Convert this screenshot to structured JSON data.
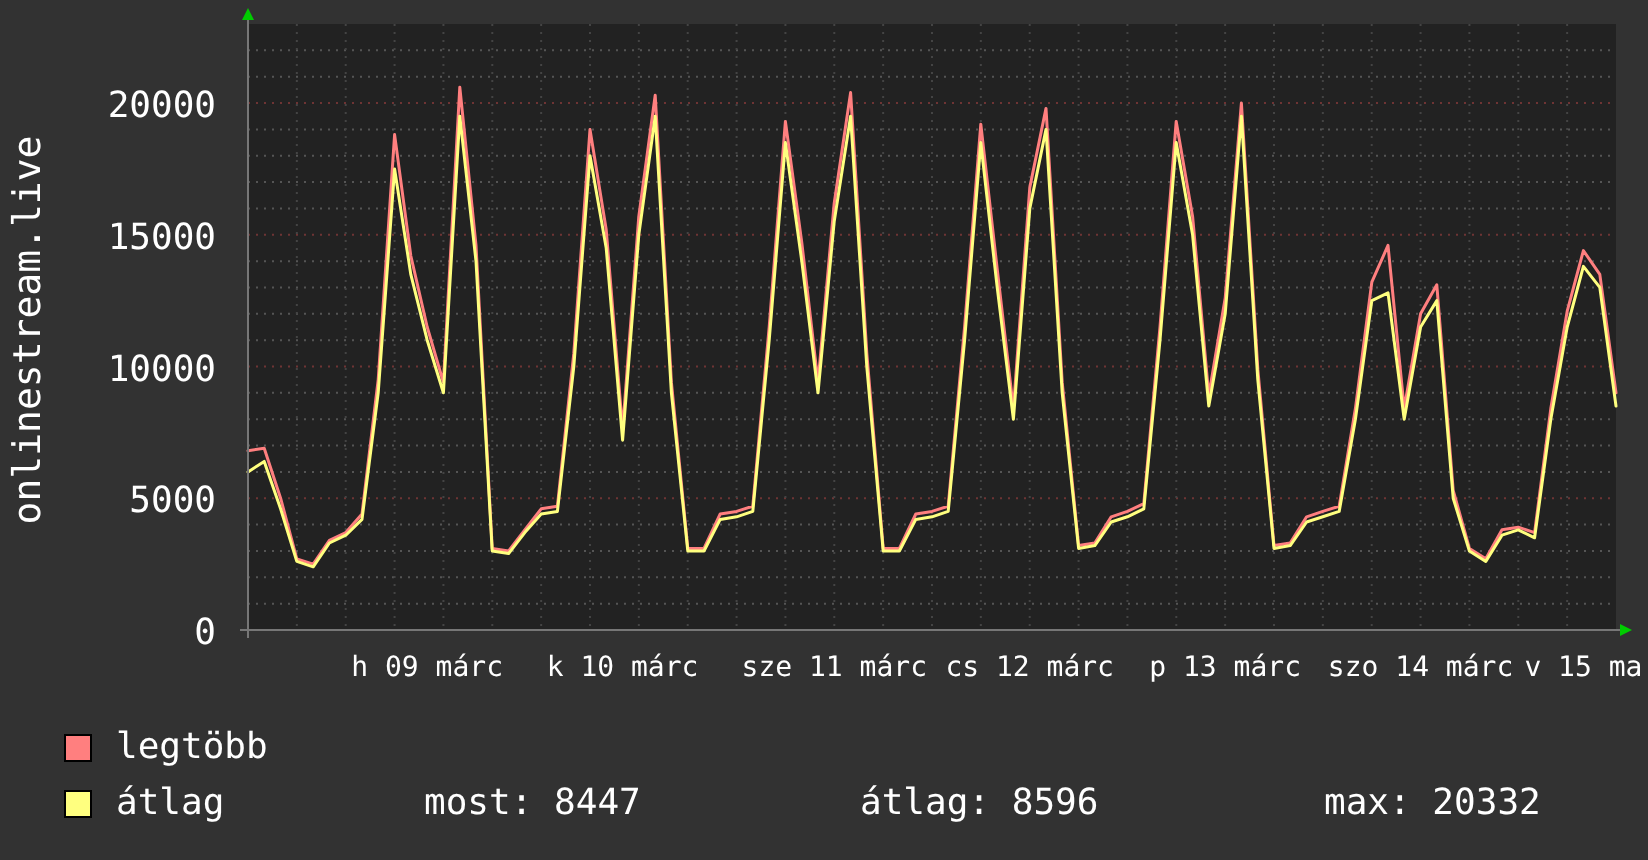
{
  "chart_data": {
    "type": "line",
    "ylabel": "onlinestream.live",
    "categories": [
      null,
      null,
      null,
      null,
      null,
      null,
      null,
      null,
      null,
      null,
      null,
      "h 09 márc",
      null,
      null,
      null,
      null,
      null,
      null,
      null,
      null,
      null,
      null,
      null,
      "k 10 márc",
      null,
      null,
      null,
      null,
      null,
      null,
      null,
      null,
      null,
      null,
      null,
      null,
      "sze 11 márc",
      null,
      null,
      null,
      null,
      null,
      null,
      null,
      null,
      null,
      null,
      null,
      "cs 12 márc",
      null,
      null,
      null,
      null,
      null,
      null,
      null,
      null,
      null,
      null,
      null,
      "p 13 márc",
      null,
      null,
      null,
      null,
      null,
      null,
      null,
      null,
      null,
      null,
      null,
      "szo 14 márc",
      null,
      null,
      null,
      null,
      null,
      null,
      null,
      null,
      null,
      "v 15 ma",
      null,
      null
    ],
    "ylim": [
      0,
      23000
    ],
    "grid": true,
    "yticks": [
      {
        "value": 0,
        "label": "0"
      },
      {
        "value": 5000,
        "label": "5000"
      },
      {
        "value": 10000,
        "label": "10000"
      },
      {
        "value": 15000,
        "label": "15000"
      },
      {
        "value": 20000,
        "label": "20000"
      }
    ],
    "series": [
      {
        "name": "legtöbb",
        "color": "#ff7f7f",
        "values": [
          6800,
          6900,
          5000,
          2700,
          2500,
          3400,
          3700,
          4400,
          9500,
          18800,
          14200,
          11500,
          9400,
          20600,
          14600,
          3100,
          3000,
          3800,
          4600,
          4700,
          10500,
          19000,
          15200,
          7600,
          15700,
          20300,
          9400,
          3100,
          3100,
          4400,
          4500,
          4700,
          11500,
          19300,
          14700,
          9400,
          16200,
          20400,
          10500,
          3100,
          3100,
          4400,
          4500,
          4700,
          11500,
          19200,
          13700,
          8400,
          16800,
          19800,
          9400,
          3200,
          3300,
          4300,
          4500,
          4800,
          11500,
          19300,
          15700,
          8900,
          12600,
          20000,
          9900,
          3200,
          3300,
          4300,
          4500,
          4700,
          8400,
          13200,
          14600,
          8400,
          12000,
          13100,
          5300,
          3100,
          2700,
          3800,
          3900,
          3700,
          8400,
          12100,
          14400,
          13500,
          9000
        ]
      },
      {
        "name": "átlag",
        "color": "#ffff7f",
        "values": [
          6000,
          6400,
          4600,
          2600,
          2400,
          3300,
          3600,
          4200,
          9000,
          17500,
          13500,
          11000,
          9000,
          19500,
          14000,
          3000,
          2900,
          3700,
          4400,
          4500,
          10000,
          18000,
          14500,
          7200,
          15000,
          19500,
          9000,
          3000,
          3000,
          4200,
          4300,
          4500,
          11000,
          18500,
          14000,
          9000,
          15500,
          19500,
          10000,
          3000,
          3000,
          4200,
          4300,
          4500,
          11000,
          18500,
          13000,
          8000,
          16000,
          19000,
          9000,
          3100,
          3200,
          4100,
          4300,
          4600,
          11000,
          18500,
          15000,
          8500,
          12000,
          19500,
          9500,
          3100,
          3200,
          4100,
          4300,
          4500,
          8000,
          12500,
          12800,
          8000,
          11500,
          12500,
          5000,
          3000,
          2600,
          3600,
          3800,
          3500,
          8000,
          11500,
          13800,
          13000,
          8500
        ]
      }
    ]
  },
  "legend_stats": [
    "most: 8447",
    "átlag: 8596",
    "max: 20332"
  ]
}
